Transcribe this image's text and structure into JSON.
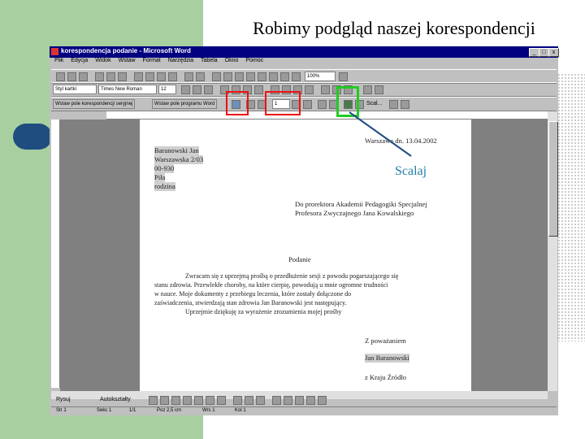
{
  "slide": {
    "title": "Robimy podgląd naszej korespondencji",
    "callout": "Scalaj"
  },
  "window": {
    "title": "korespondencja podanie - Microsoft Word",
    "controls": [
      "_",
      "□",
      "x"
    ],
    "menu": [
      "Plik",
      "Edycja",
      "Widok",
      "Wstaw",
      "Format",
      "Narzędzia",
      "Tabela",
      "Okno",
      "Pomoc"
    ]
  },
  "toolbar": {
    "style": "Styl kartki",
    "font": "Times New Roman",
    "size": "12",
    "zoom": "100%",
    "merge_field_btn": "Wstaw pole korespondencji seryjnej",
    "word_field_btn": "Wstaw pole programu Word",
    "record_number": "1",
    "merge_label": "Scal..."
  },
  "document": {
    "date": "Warszawa dn. 13.04.2002",
    "sender": [
      "Baranowski Jan",
      "Warszawska 2/03",
      "00-930",
      "Piła",
      "rodzina"
    ],
    "recipient": [
      "Do prorektora Akademii Pedagogiki Specjalnej",
      "Profesora Zwyczajnego Jana Kowalskiego"
    ],
    "subject": "Podanie",
    "body": [
      "Zwracam się z uprzejmą prośbą o przedłużenie sesji z powodu pogarszającego się",
      "stanu zdrowia. Przewlekłe choroby, na które cierpię, powodują u mnie ogromne trudności",
      "w nauce. Moje dokumenty z przebiegu leczenia, które zostały dołączone do",
      "zaświadczenia, stwierdzają stan zdrowia Jan Baranowski jest następujący.",
      "Uprzejmie dziękuję za wyrażenie zrozumienia mojej prośby"
    ],
    "closing": "Z poważaniem",
    "signature": "Jan Baranowski",
    "tag_line": "z Kraju Źródło"
  },
  "drawbar": {
    "draw": "Rysuj",
    "autoshapes": "Autokształty"
  },
  "status": {
    "page": "Str 1",
    "sec": "Sekc 1",
    "pages": "1/1",
    "pos": "Poz 2,5 cm",
    "line": "Wrs 1",
    "col": "Kol 1"
  }
}
